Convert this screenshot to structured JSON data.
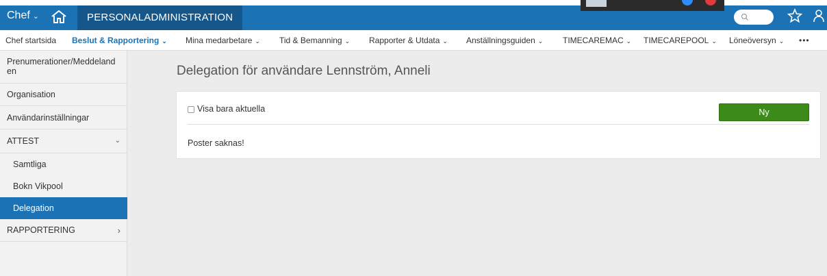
{
  "topbar": {
    "role": "Chef",
    "app_title": "PERSONALADMINISTRATION",
    "colors": {
      "bar": "#1b73b6",
      "title_bg": "#15578b"
    },
    "icons": [
      "chevron-down-icon",
      "home-icon",
      "search-icon",
      "star-icon",
      "user-settings-icon"
    ]
  },
  "nav": {
    "items": [
      {
        "label": "Chef startsida",
        "has_caret": false
      },
      {
        "label": "Beslut & Rapportering",
        "has_caret": true,
        "active": true
      },
      {
        "label": "Mina medarbetare",
        "has_caret": true
      },
      {
        "label": "Tid & Bemanning",
        "has_caret": true
      },
      {
        "label": "Rapporter & Utdata",
        "has_caret": true
      },
      {
        "label": "Anställningsguiden",
        "has_caret": true
      },
      {
        "label": "TIMECAREMAC",
        "has_caret": true
      },
      {
        "label": "TIMECAREPOOL",
        "has_caret": true
      },
      {
        "label": "Löneöversyn",
        "has_caret": true
      }
    ],
    "more": "•••",
    "caret": "⌄"
  },
  "sidebar": {
    "items": [
      {
        "label": "Prenumerationer/Meddelanden"
      },
      {
        "label": "Organisation"
      },
      {
        "label": "Användarinställningar"
      },
      {
        "label": "ATTEST",
        "arrow": "⌄"
      },
      {
        "label": "Samtliga"
      },
      {
        "label": "Bokn Vikpool"
      },
      {
        "label": "Delegation",
        "active": true
      },
      {
        "label": "RAPPORTERING",
        "arrow": "›"
      }
    ],
    "colors": {
      "active": "#1b73b6"
    }
  },
  "main": {
    "title": "Delegation för användare Lennström, Anneli",
    "checkbox_label": "Visa bara aktuella",
    "checkbox_checked": false,
    "new_button": "Ny",
    "empty_message": "Poster saknas!",
    "colors": {
      "button": "#3c8a1a"
    }
  }
}
